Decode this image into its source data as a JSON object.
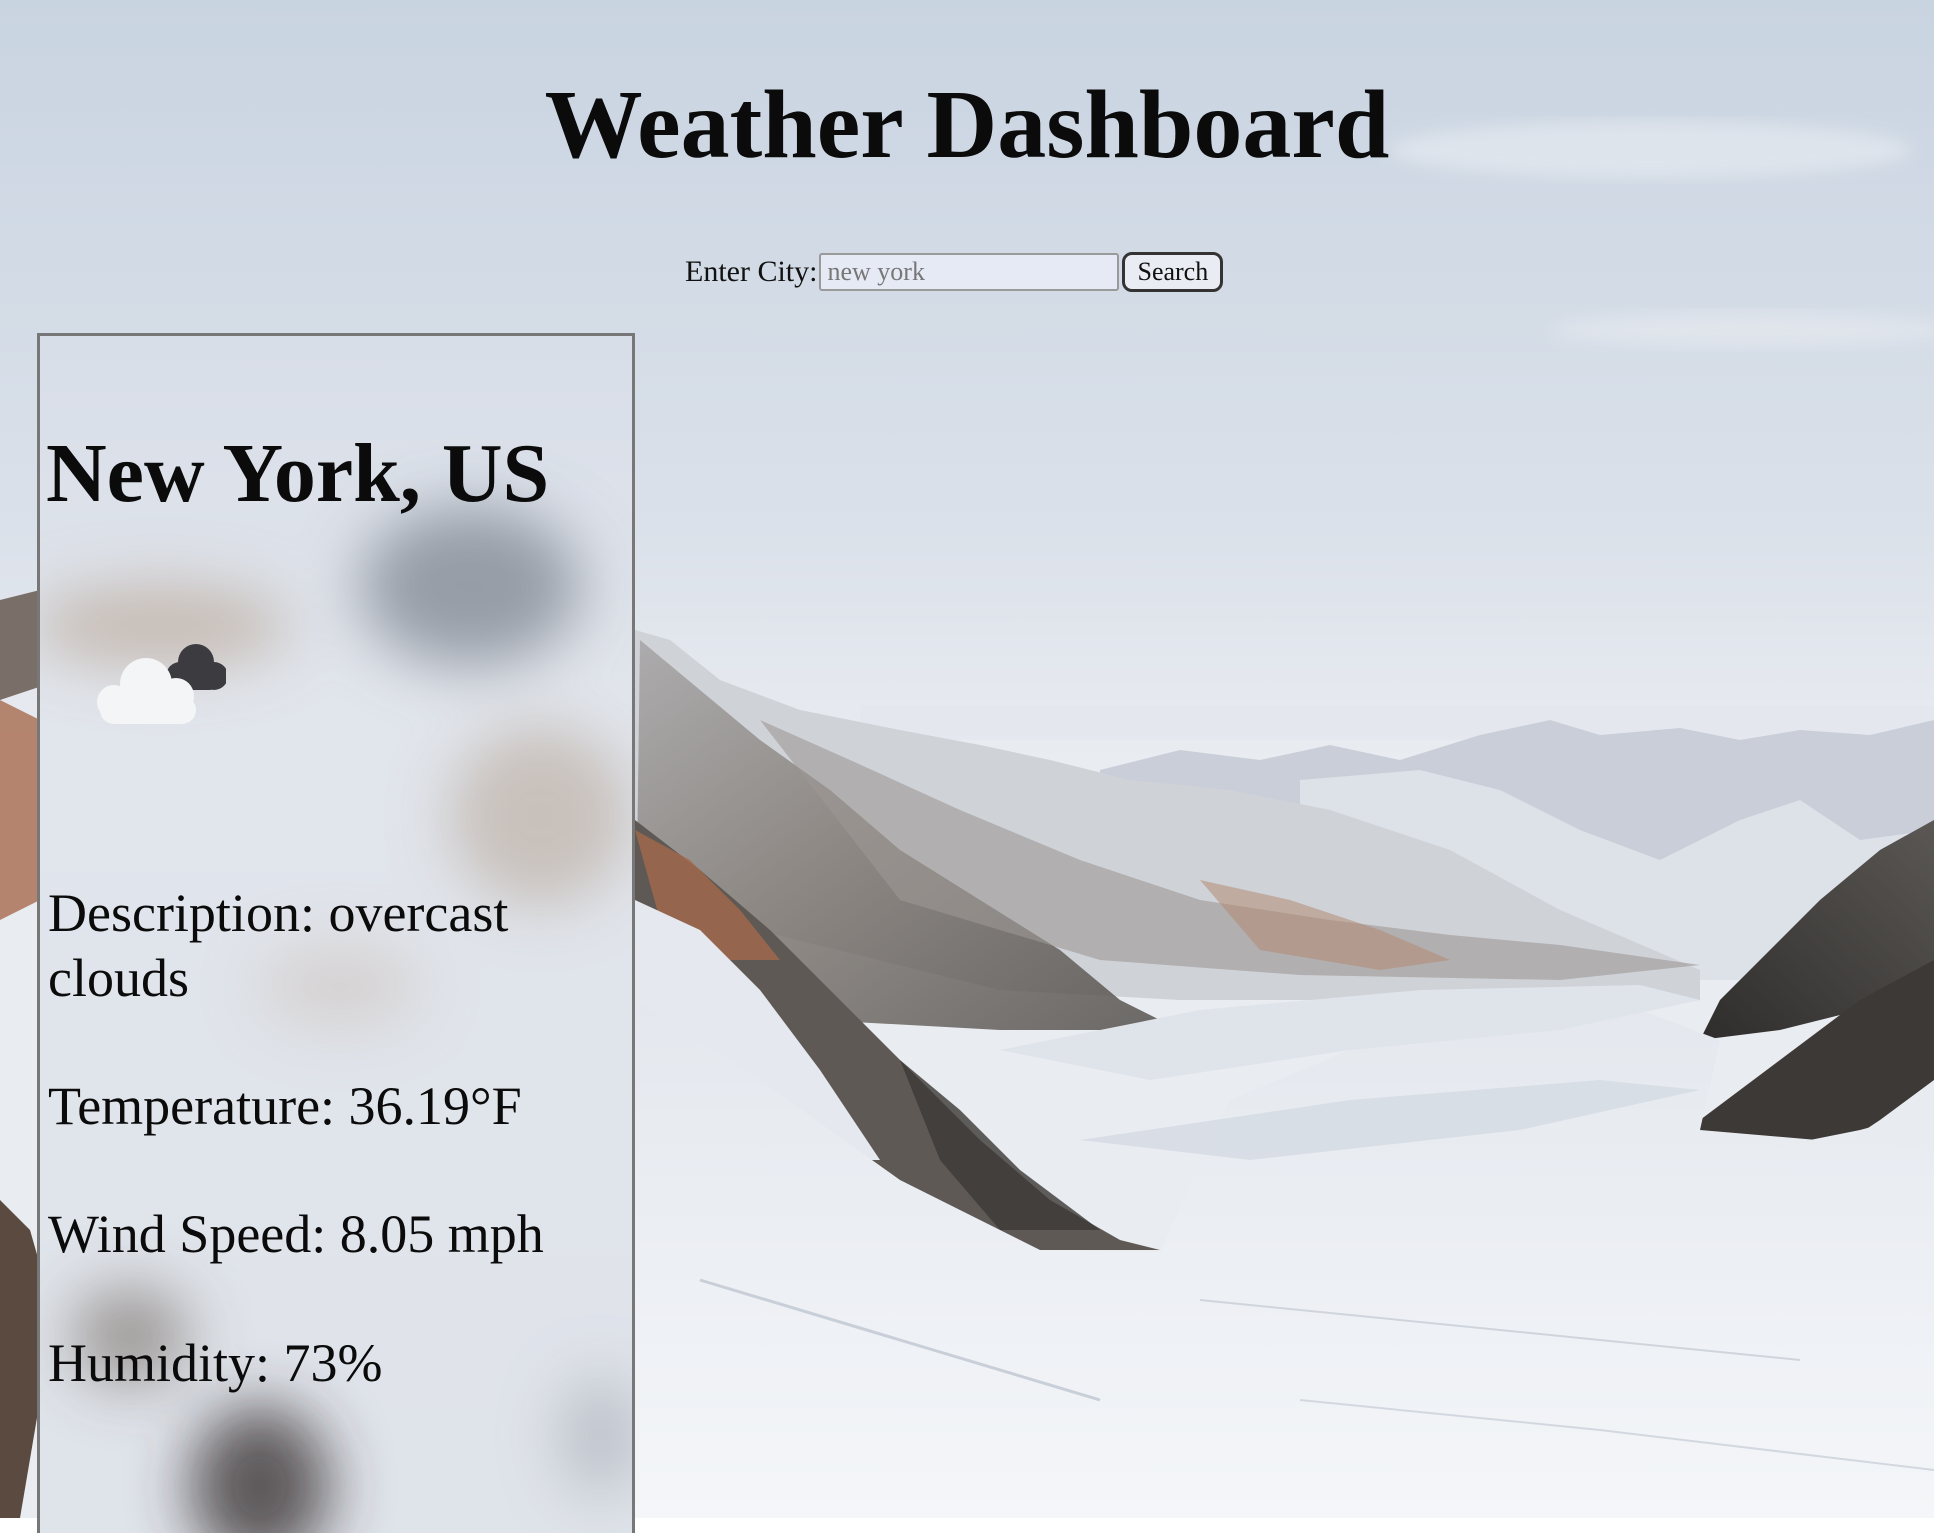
{
  "page": {
    "title": "Weather Dashboard"
  },
  "search": {
    "label": "Enter City:",
    "value": "",
    "placeholder": "new york",
    "button_label": "Search"
  },
  "weather": {
    "city": "New York, US",
    "icon": "overcast-clouds-icon",
    "description": "Description: overcast clouds",
    "temperature": "Temperature: 36.19°F",
    "wind_speed": "Wind Speed: 8.05 mph",
    "humidity": "Humidity: 73%"
  },
  "colors": {
    "sky": "#d4dbe5",
    "snow": "#eef1f5",
    "rock": "#6b6560",
    "rust": "#b27a5a",
    "card_border": "#777777",
    "input_bg": "#e6eaf5"
  }
}
